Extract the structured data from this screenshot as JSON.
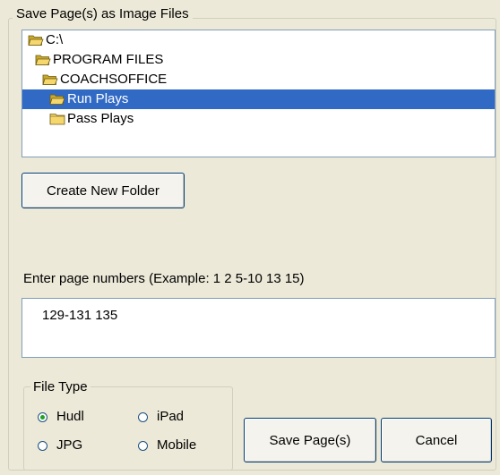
{
  "window": {
    "group_title": "Save Page(s) as Image Files"
  },
  "folders": [
    {
      "label": "C:\\",
      "selected": false
    },
    {
      "label": "PROGRAM FILES",
      "selected": false
    },
    {
      "label": "COACHSOFFICE",
      "selected": false
    },
    {
      "label": "Run Plays",
      "selected": true
    },
    {
      "label": "Pass Plays",
      "selected": false
    }
  ],
  "buttons": {
    "create_folder": "Create New Folder",
    "save": "Save Page(s)",
    "cancel": "Cancel"
  },
  "pages": {
    "prompt": "Enter page numbers (Example: 1 2 5-10 13 15)",
    "value": "129-131 135"
  },
  "file_type": {
    "title": "File Type",
    "options": [
      {
        "label": "Hudl",
        "checked": true
      },
      {
        "label": "iPad",
        "checked": false
      },
      {
        "label": "JPG",
        "checked": false
      },
      {
        "label": "Mobile",
        "checked": false
      }
    ]
  },
  "colors": {
    "selection": "#316ac5",
    "dialog_bg": "#ece9d8",
    "folder_yellow": "#f5d76e"
  }
}
